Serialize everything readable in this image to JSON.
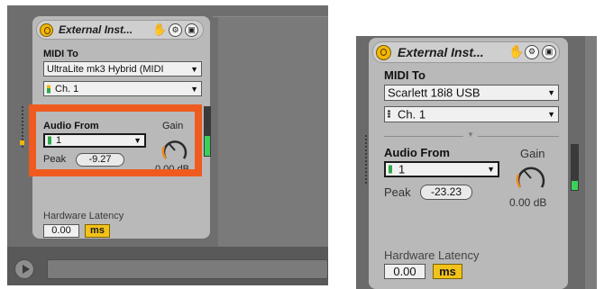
{
  "left": {
    "device_title": "External Inst...",
    "midi_to_label": "MIDI To",
    "midi_to_value": "UltraLite mk3 Hybrid (MIDI",
    "channel_value": "Ch. 1",
    "audio_from_label": "Audio From",
    "audio_from_value": "1",
    "gain_label": "Gain",
    "gain_value": "0.00 dB",
    "peak_label": "Peak",
    "peak_value": "-9.27",
    "latency_label": "Hardware Latency",
    "latency_value": "0.00",
    "latency_unit": "ms",
    "highlight_color": "#ef5b1e"
  },
  "right": {
    "device_title": "External Inst...",
    "midi_to_label": "MIDI To",
    "midi_to_value": "Scarlett 18i8 USB",
    "channel_value": "Ch. 1",
    "audio_from_label": "Audio From",
    "audio_from_value": "1",
    "gain_label": "Gain",
    "gain_value": "0.00 dB",
    "peak_label": "Peak",
    "peak_value": "-23.23",
    "latency_label": "Hardware Latency",
    "latency_value": "0.00",
    "latency_unit": "ms"
  },
  "colors": {
    "power_button": "#f2b705",
    "ms_button": "#f2c21a",
    "meter_level": "#3bd05a",
    "knob_arc": "#f08a1e"
  },
  "icons": [
    "power-icon",
    "hand-icon",
    "settings-icon",
    "save-icon",
    "dropdown-arrow-icon",
    "play-icon"
  ]
}
